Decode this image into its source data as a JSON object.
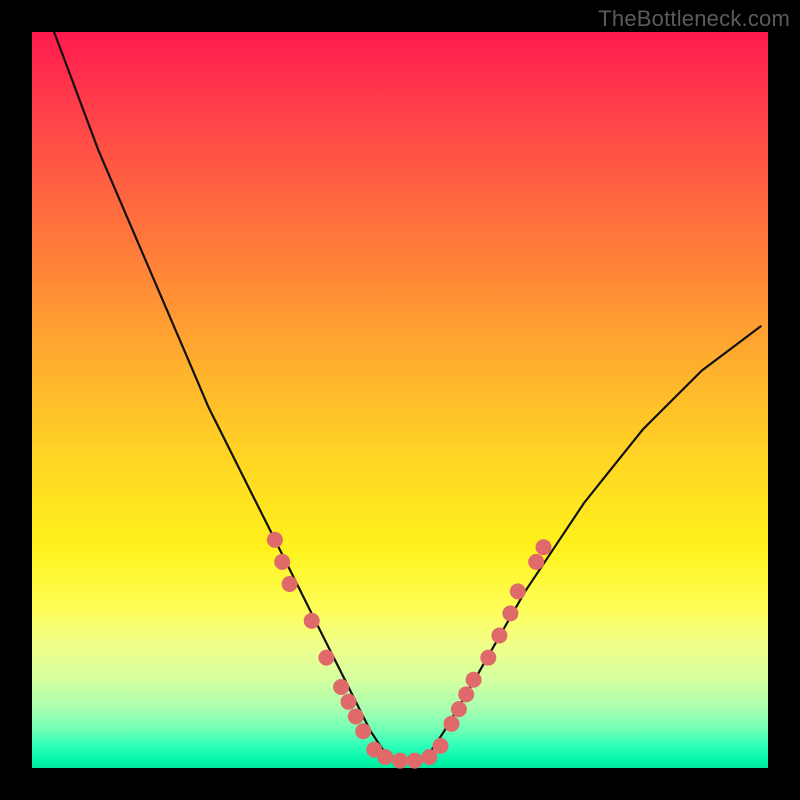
{
  "watermark": "TheBottleneck.com",
  "palette": {
    "bead": "#e06a6a",
    "curve": "#111111",
    "frame": "#000000"
  },
  "chart_data": {
    "type": "line",
    "title": "",
    "xlabel": "",
    "ylabel": "",
    "xlim": [
      0,
      100
    ],
    "ylim": [
      0,
      100
    ],
    "grid": false,
    "legend": false,
    "series": [
      {
        "name": "curve",
        "x": [
          3,
          6,
          9,
          12,
          15,
          18,
          21,
          24,
          27,
          30,
          33,
          36,
          39,
          42,
          44,
          46,
          48,
          50,
          52,
          54,
          56,
          59,
          63,
          67,
          71,
          75,
          79,
          83,
          87,
          91,
          95,
          99
        ],
        "y": [
          100,
          92,
          84,
          77,
          70,
          63,
          56,
          49,
          43,
          37,
          31,
          25,
          19,
          13,
          9,
          5,
          2,
          1,
          1,
          2,
          5,
          10,
          17,
          24,
          30,
          36,
          41,
          46,
          50,
          54,
          57,
          60
        ]
      }
    ],
    "beads": {
      "name": "markers",
      "points": [
        {
          "x": 33,
          "y": 31
        },
        {
          "x": 34,
          "y": 28
        },
        {
          "x": 35,
          "y": 25
        },
        {
          "x": 38,
          "y": 20
        },
        {
          "x": 40,
          "y": 15
        },
        {
          "x": 42,
          "y": 11
        },
        {
          "x": 43,
          "y": 9
        },
        {
          "x": 44,
          "y": 7
        },
        {
          "x": 45,
          "y": 5
        },
        {
          "x": 46.5,
          "y": 2.5
        },
        {
          "x": 48,
          "y": 1.5
        },
        {
          "x": 50,
          "y": 1
        },
        {
          "x": 52,
          "y": 1
        },
        {
          "x": 54,
          "y": 1.5
        },
        {
          "x": 55.5,
          "y": 3
        },
        {
          "x": 57,
          "y": 6
        },
        {
          "x": 58,
          "y": 8
        },
        {
          "x": 59,
          "y": 10
        },
        {
          "x": 60,
          "y": 12
        },
        {
          "x": 62,
          "y": 15
        },
        {
          "x": 63.5,
          "y": 18
        },
        {
          "x": 65,
          "y": 21
        },
        {
          "x": 66,
          "y": 24
        },
        {
          "x": 68.5,
          "y": 28
        },
        {
          "x": 69.5,
          "y": 30
        }
      ]
    }
  }
}
